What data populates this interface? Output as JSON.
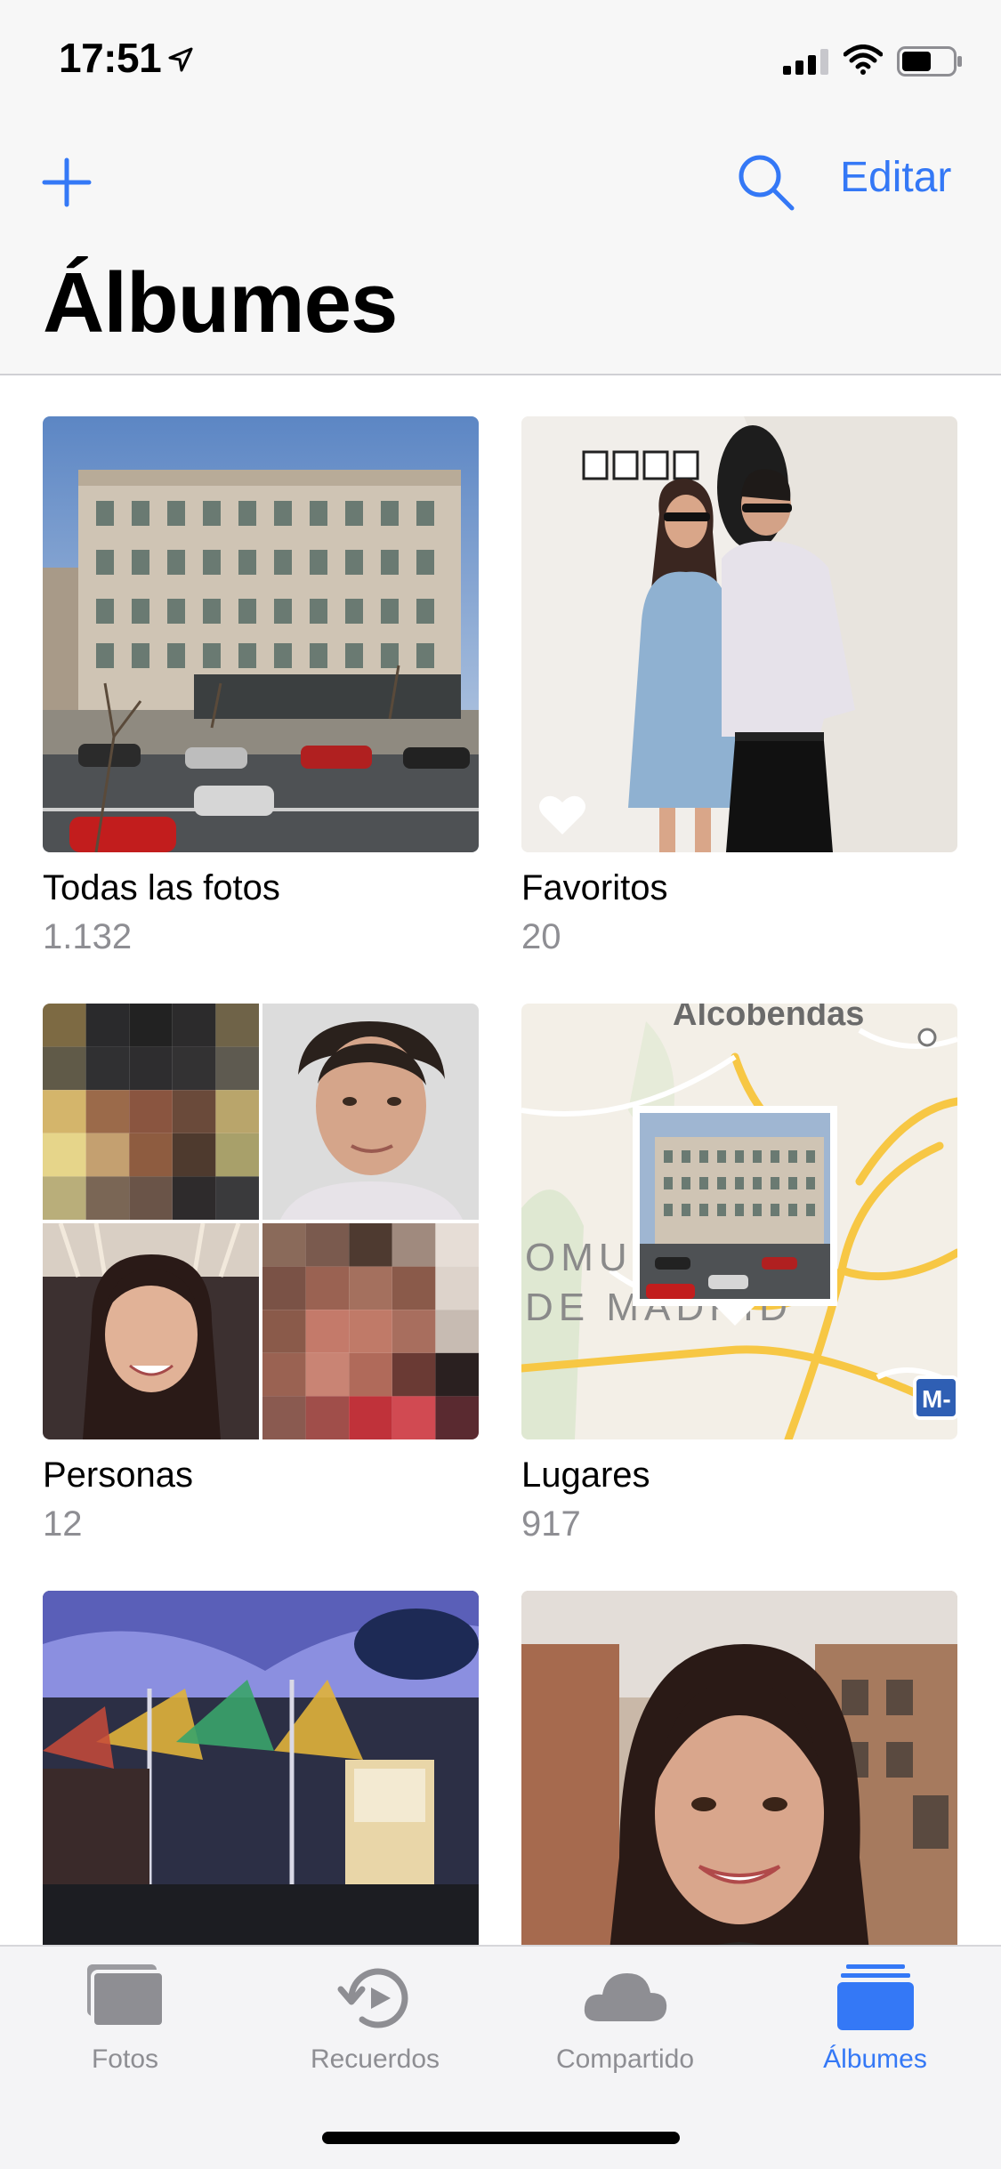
{
  "status": {
    "time": "17:51"
  },
  "nav": {
    "edit_label": "Editar",
    "title": "Álbumes"
  },
  "albums": [
    {
      "title": "Todas las fotos",
      "count": "1.132"
    },
    {
      "title": "Favoritos",
      "count": "20"
    },
    {
      "title": "Personas",
      "count": "12"
    },
    {
      "title": "Lugares",
      "count": "917"
    }
  ],
  "map_labels": {
    "top": "Alcobendas",
    "mid1": "OMU",
    "mid2": "DE MADRID",
    "road": "M-"
  },
  "tabs": [
    {
      "label": "Fotos",
      "icon": "photos-stack-icon"
    },
    {
      "label": "Recuerdos",
      "icon": "memories-icon"
    },
    {
      "label": "Compartido",
      "icon": "cloud-icon"
    },
    {
      "label": "Álbumes",
      "icon": "albums-icon"
    }
  ],
  "colors": {
    "accent": "#3478f6",
    "secondary_text": "#8e8e93",
    "bar_bg": "#f7f7f7"
  }
}
